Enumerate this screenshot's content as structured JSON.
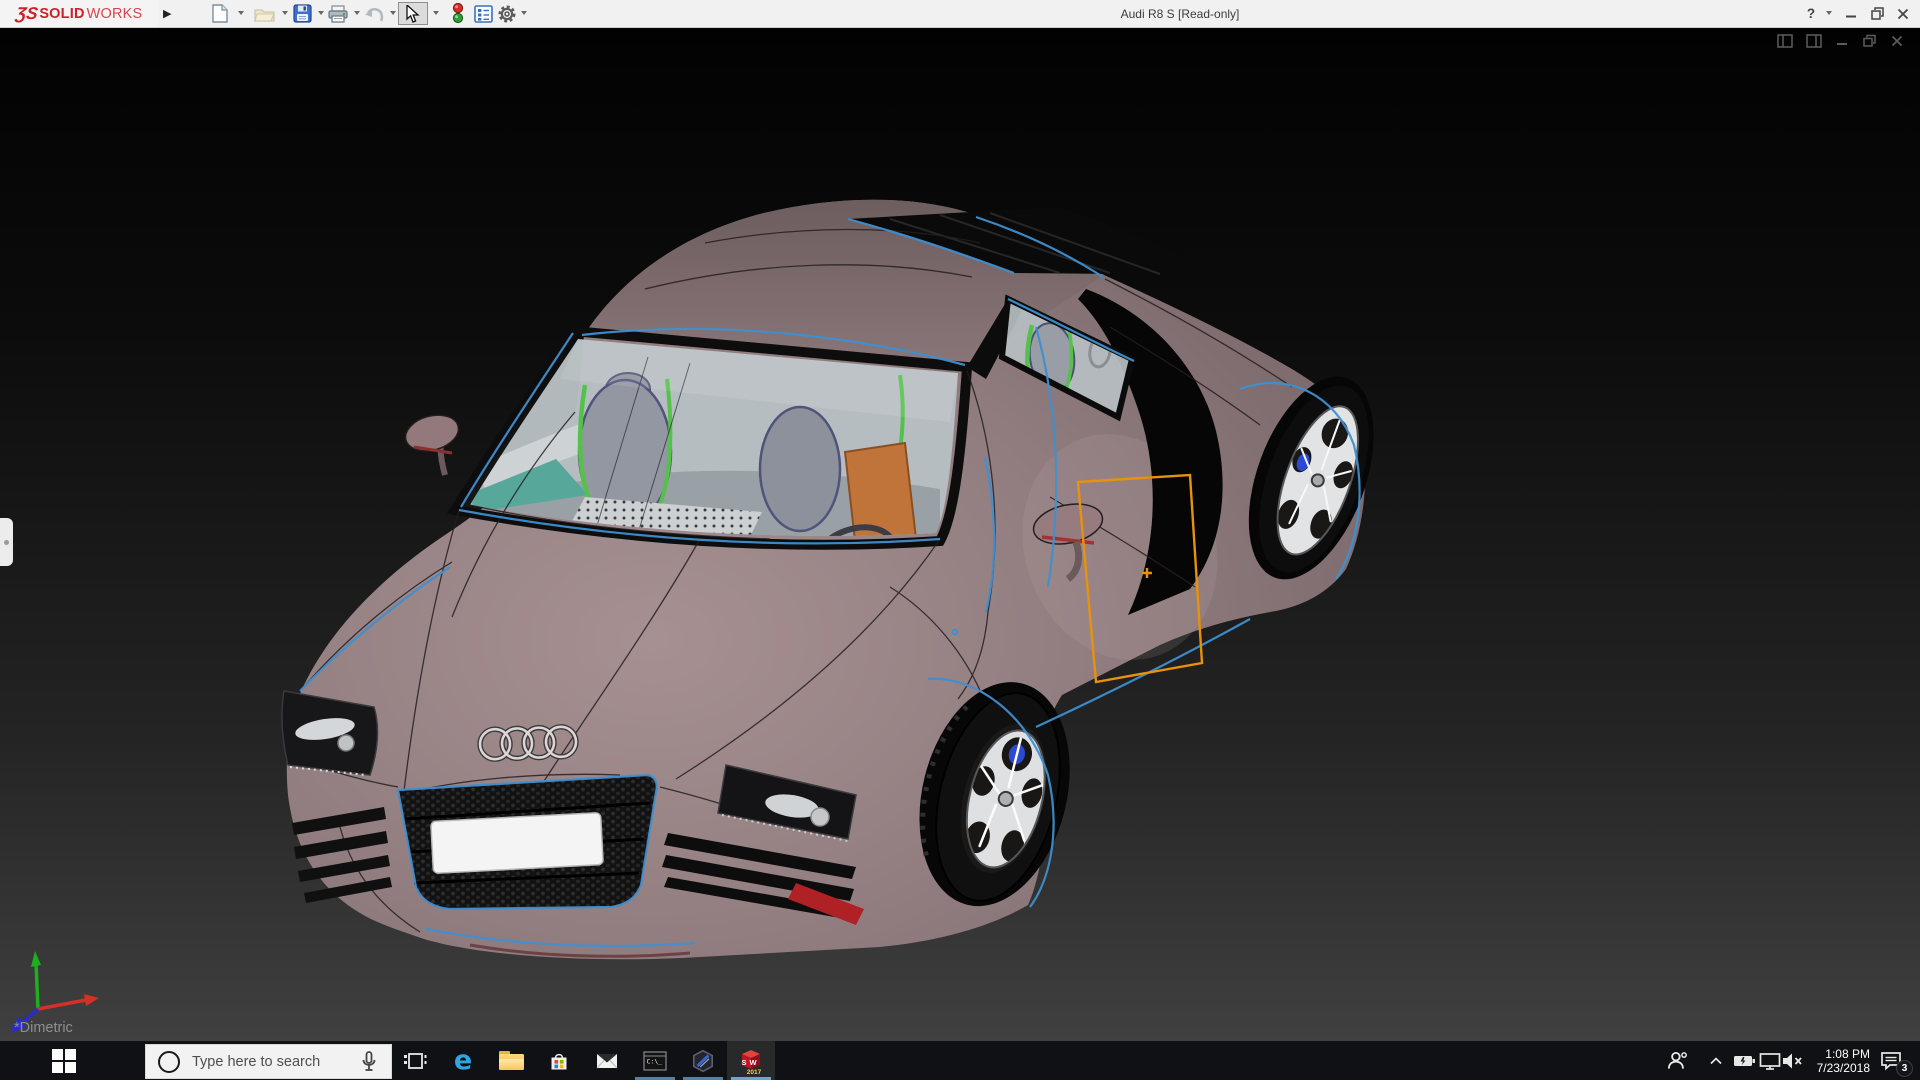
{
  "titlebar": {
    "logo": {
      "mark": "ƷS",
      "bold": "SOLID",
      "light": "WORKS"
    },
    "flyout_arrow": "▶",
    "title": "Audi R8 S [Read-only]",
    "help_label": "?",
    "toolbar_items": [
      {
        "name": "new-document",
        "enabled": true,
        "has_dropdown": true
      },
      {
        "name": "open",
        "enabled": false,
        "has_dropdown": true
      },
      {
        "name": "save",
        "enabled": true,
        "has_dropdown": true
      },
      {
        "name": "print",
        "enabled": true,
        "has_dropdown": true
      },
      {
        "name": "undo",
        "enabled": false,
        "has_dropdown": true
      },
      {
        "name": "select",
        "enabled": true,
        "selected": true,
        "has_dropdown": true
      },
      {
        "name": "stoplight-macro",
        "enabled": true,
        "has_dropdown": false
      },
      {
        "name": "design-binder",
        "enabled": true,
        "has_dropdown": false
      },
      {
        "name": "options-gear",
        "enabled": true,
        "has_dropdown": true
      }
    ],
    "window_controls": [
      "help",
      "minimize",
      "restore-down",
      "close"
    ]
  },
  "viewport": {
    "view_orientation_label": "*Dimetric",
    "document_window_controls": [
      "pane-left",
      "pane-right",
      "minimize",
      "restore",
      "close"
    ],
    "triad": {
      "x_color": "#d43026",
      "y_color": "#1fae1f",
      "z_color": "#2a2ad4"
    },
    "background_top": "#020202",
    "background_bottom": "#404040"
  },
  "model": {
    "document_name": "Audi R8 S",
    "colors": {
      "body": "#927e80",
      "edge_highlight_blue": "#3f8fd0",
      "sketch_orange": "#e8920a",
      "interior_green": "#54c24a",
      "interior_orange": "#c0743a",
      "interior_teal": "#57a89a",
      "caliper_blue": "#2c4ad0",
      "accent_red": "#b02125"
    }
  },
  "taskbar": {
    "search": {
      "placeholder": "Type here to search"
    },
    "apps": [
      {
        "name": "task-view",
        "running": false
      },
      {
        "name": "microsoft-edge",
        "running": false,
        "glyph": "e"
      },
      {
        "name": "file-explorer",
        "running": false
      },
      {
        "name": "microsoft-store",
        "running": false
      },
      {
        "name": "mail",
        "running": false
      },
      {
        "name": "command-prompt",
        "running": true,
        "label": "C:\\_"
      },
      {
        "name": "hexagon-3d-app",
        "running": true
      },
      {
        "name": "solidworks-2017",
        "running": true,
        "active": true,
        "letters": "SW",
        "year": "2017"
      }
    ],
    "tray": {
      "icons": [
        "people",
        "hidden-icons-chevron",
        "battery-charging",
        "network-display",
        "volume-muted",
        "action-center"
      ],
      "time": "1:08 PM",
      "date": "7/23/2018",
      "action_center_badge": "3"
    }
  }
}
